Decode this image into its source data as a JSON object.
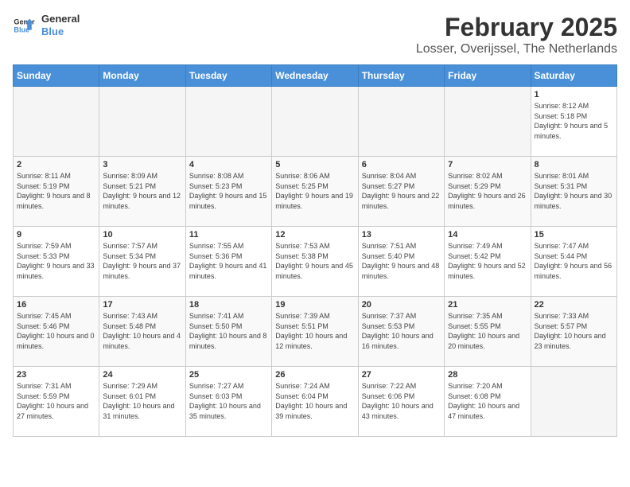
{
  "logo": {
    "line1": "General",
    "line2": "Blue"
  },
  "title": "February 2025",
  "subtitle": "Losser, Overijssel, The Netherlands",
  "weekdays": [
    "Sunday",
    "Monday",
    "Tuesday",
    "Wednesday",
    "Thursday",
    "Friday",
    "Saturday"
  ],
  "weeks": [
    [
      {
        "day": "",
        "info": ""
      },
      {
        "day": "",
        "info": ""
      },
      {
        "day": "",
        "info": ""
      },
      {
        "day": "",
        "info": ""
      },
      {
        "day": "",
        "info": ""
      },
      {
        "day": "",
        "info": ""
      },
      {
        "day": "1",
        "info": "Sunrise: 8:12 AM\nSunset: 5:18 PM\nDaylight: 9 hours and 5 minutes."
      }
    ],
    [
      {
        "day": "2",
        "info": "Sunrise: 8:11 AM\nSunset: 5:19 PM\nDaylight: 9 hours and 8 minutes."
      },
      {
        "day": "3",
        "info": "Sunrise: 8:09 AM\nSunset: 5:21 PM\nDaylight: 9 hours and 12 minutes."
      },
      {
        "day": "4",
        "info": "Sunrise: 8:08 AM\nSunset: 5:23 PM\nDaylight: 9 hours and 15 minutes."
      },
      {
        "day": "5",
        "info": "Sunrise: 8:06 AM\nSunset: 5:25 PM\nDaylight: 9 hours and 19 minutes."
      },
      {
        "day": "6",
        "info": "Sunrise: 8:04 AM\nSunset: 5:27 PM\nDaylight: 9 hours and 22 minutes."
      },
      {
        "day": "7",
        "info": "Sunrise: 8:02 AM\nSunset: 5:29 PM\nDaylight: 9 hours and 26 minutes."
      },
      {
        "day": "8",
        "info": "Sunrise: 8:01 AM\nSunset: 5:31 PM\nDaylight: 9 hours and 30 minutes."
      }
    ],
    [
      {
        "day": "9",
        "info": "Sunrise: 7:59 AM\nSunset: 5:33 PM\nDaylight: 9 hours and 33 minutes."
      },
      {
        "day": "10",
        "info": "Sunrise: 7:57 AM\nSunset: 5:34 PM\nDaylight: 9 hours and 37 minutes."
      },
      {
        "day": "11",
        "info": "Sunrise: 7:55 AM\nSunset: 5:36 PM\nDaylight: 9 hours and 41 minutes."
      },
      {
        "day": "12",
        "info": "Sunrise: 7:53 AM\nSunset: 5:38 PM\nDaylight: 9 hours and 45 minutes."
      },
      {
        "day": "13",
        "info": "Sunrise: 7:51 AM\nSunset: 5:40 PM\nDaylight: 9 hours and 48 minutes."
      },
      {
        "day": "14",
        "info": "Sunrise: 7:49 AM\nSunset: 5:42 PM\nDaylight: 9 hours and 52 minutes."
      },
      {
        "day": "15",
        "info": "Sunrise: 7:47 AM\nSunset: 5:44 PM\nDaylight: 9 hours and 56 minutes."
      }
    ],
    [
      {
        "day": "16",
        "info": "Sunrise: 7:45 AM\nSunset: 5:46 PM\nDaylight: 10 hours and 0 minutes."
      },
      {
        "day": "17",
        "info": "Sunrise: 7:43 AM\nSunset: 5:48 PM\nDaylight: 10 hours and 4 minutes."
      },
      {
        "day": "18",
        "info": "Sunrise: 7:41 AM\nSunset: 5:50 PM\nDaylight: 10 hours and 8 minutes."
      },
      {
        "day": "19",
        "info": "Sunrise: 7:39 AM\nSunset: 5:51 PM\nDaylight: 10 hours and 12 minutes."
      },
      {
        "day": "20",
        "info": "Sunrise: 7:37 AM\nSunset: 5:53 PM\nDaylight: 10 hours and 16 minutes."
      },
      {
        "day": "21",
        "info": "Sunrise: 7:35 AM\nSunset: 5:55 PM\nDaylight: 10 hours and 20 minutes."
      },
      {
        "day": "22",
        "info": "Sunrise: 7:33 AM\nSunset: 5:57 PM\nDaylight: 10 hours and 23 minutes."
      }
    ],
    [
      {
        "day": "23",
        "info": "Sunrise: 7:31 AM\nSunset: 5:59 PM\nDaylight: 10 hours and 27 minutes."
      },
      {
        "day": "24",
        "info": "Sunrise: 7:29 AM\nSunset: 6:01 PM\nDaylight: 10 hours and 31 minutes."
      },
      {
        "day": "25",
        "info": "Sunrise: 7:27 AM\nSunset: 6:03 PM\nDaylight: 10 hours and 35 minutes."
      },
      {
        "day": "26",
        "info": "Sunrise: 7:24 AM\nSunset: 6:04 PM\nDaylight: 10 hours and 39 minutes."
      },
      {
        "day": "27",
        "info": "Sunrise: 7:22 AM\nSunset: 6:06 PM\nDaylight: 10 hours and 43 minutes."
      },
      {
        "day": "28",
        "info": "Sunrise: 7:20 AM\nSunset: 6:08 PM\nDaylight: 10 hours and 47 minutes."
      },
      {
        "day": "",
        "info": ""
      }
    ]
  ]
}
